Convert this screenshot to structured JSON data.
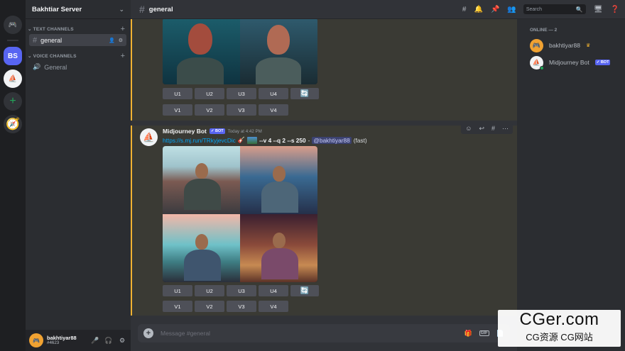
{
  "server_rail": {
    "server_initials": "BS"
  },
  "sidebar": {
    "server_name": "Bakhtiar Server",
    "text_category": "TEXT CHANNELS",
    "voice_category": "VOICE CHANNELS",
    "text_channels": [
      {
        "label": "general"
      }
    ],
    "voice_channels": [
      {
        "label": "General"
      }
    ]
  },
  "user": {
    "name": "bakhtiyar88",
    "tag": "#4623"
  },
  "topbar": {
    "channel": "general",
    "search_placeholder": "Search"
  },
  "message": {
    "author": "Midjourney Bot",
    "badge": "✓ BOT",
    "timestamp": "Today at 4:42 PM",
    "link": "https://s.mj.run/TRkyjevcDic",
    "params": "--v 4 --q 2 --s 250",
    "dash": "-",
    "mention": "@bakhtiyar88",
    "speed": "(fast)"
  },
  "buttons": {
    "upscale": [
      "U1",
      "U2",
      "U3",
      "U4"
    ],
    "variation": [
      "V1",
      "V2",
      "V3",
      "V4"
    ],
    "reroll": "🔄"
  },
  "composer": {
    "placeholder": "Message #general"
  },
  "members": {
    "header": "ONLINE — 2",
    "list": [
      {
        "name": "bakhtiyar88",
        "crown": "♛"
      },
      {
        "name": "Midjourney Bot",
        "badge": "✓ BOT"
      }
    ]
  },
  "watermark": {
    "line1": "CGer.com",
    "line2": "CG资源 CG网站"
  }
}
